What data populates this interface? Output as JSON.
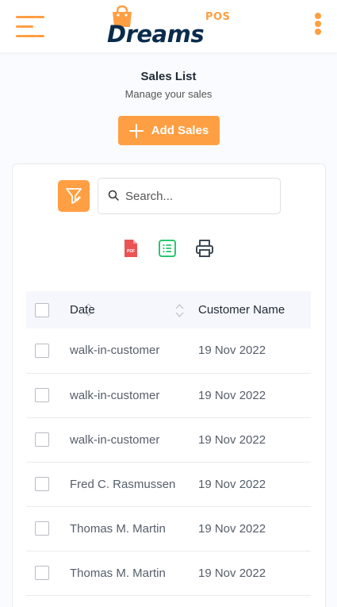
{
  "header": {
    "logo_text": "Dreams",
    "logo_pos": "POS"
  },
  "page": {
    "title": "Sales List",
    "subtitle": "Manage your sales",
    "add_button_label": "Add Sales"
  },
  "toolbar": {
    "search_placeholder": "Search..."
  },
  "table": {
    "columns": [
      "Date",
      "Customer Name"
    ],
    "rows": [
      {
        "customer": "walk-in-customer",
        "date": "19 Nov 2022"
      },
      {
        "customer": "walk-in-customer",
        "date": "19 Nov 2022"
      },
      {
        "customer": "walk-in-customer",
        "date": "19 Nov 2022"
      },
      {
        "customer": "Fred C. Rasmussen",
        "date": "19 Nov 2022"
      },
      {
        "customer": "Thomas M. Martin",
        "date": "19 Nov 2022"
      },
      {
        "customer": "Thomas M. Martin",
        "date": "19 Nov 2022"
      }
    ]
  },
  "colors": {
    "accent": "#ff9f43",
    "brand_dark": "#092c4c",
    "pdf_red": "#ea5455",
    "excel_green": "#28c76f"
  },
  "icons": [
    "hamburger-icon",
    "kebab-menu-icon",
    "filter-icon",
    "search-icon",
    "pdf-icon",
    "excel-icon",
    "printer-icon",
    "sort-icon"
  ]
}
